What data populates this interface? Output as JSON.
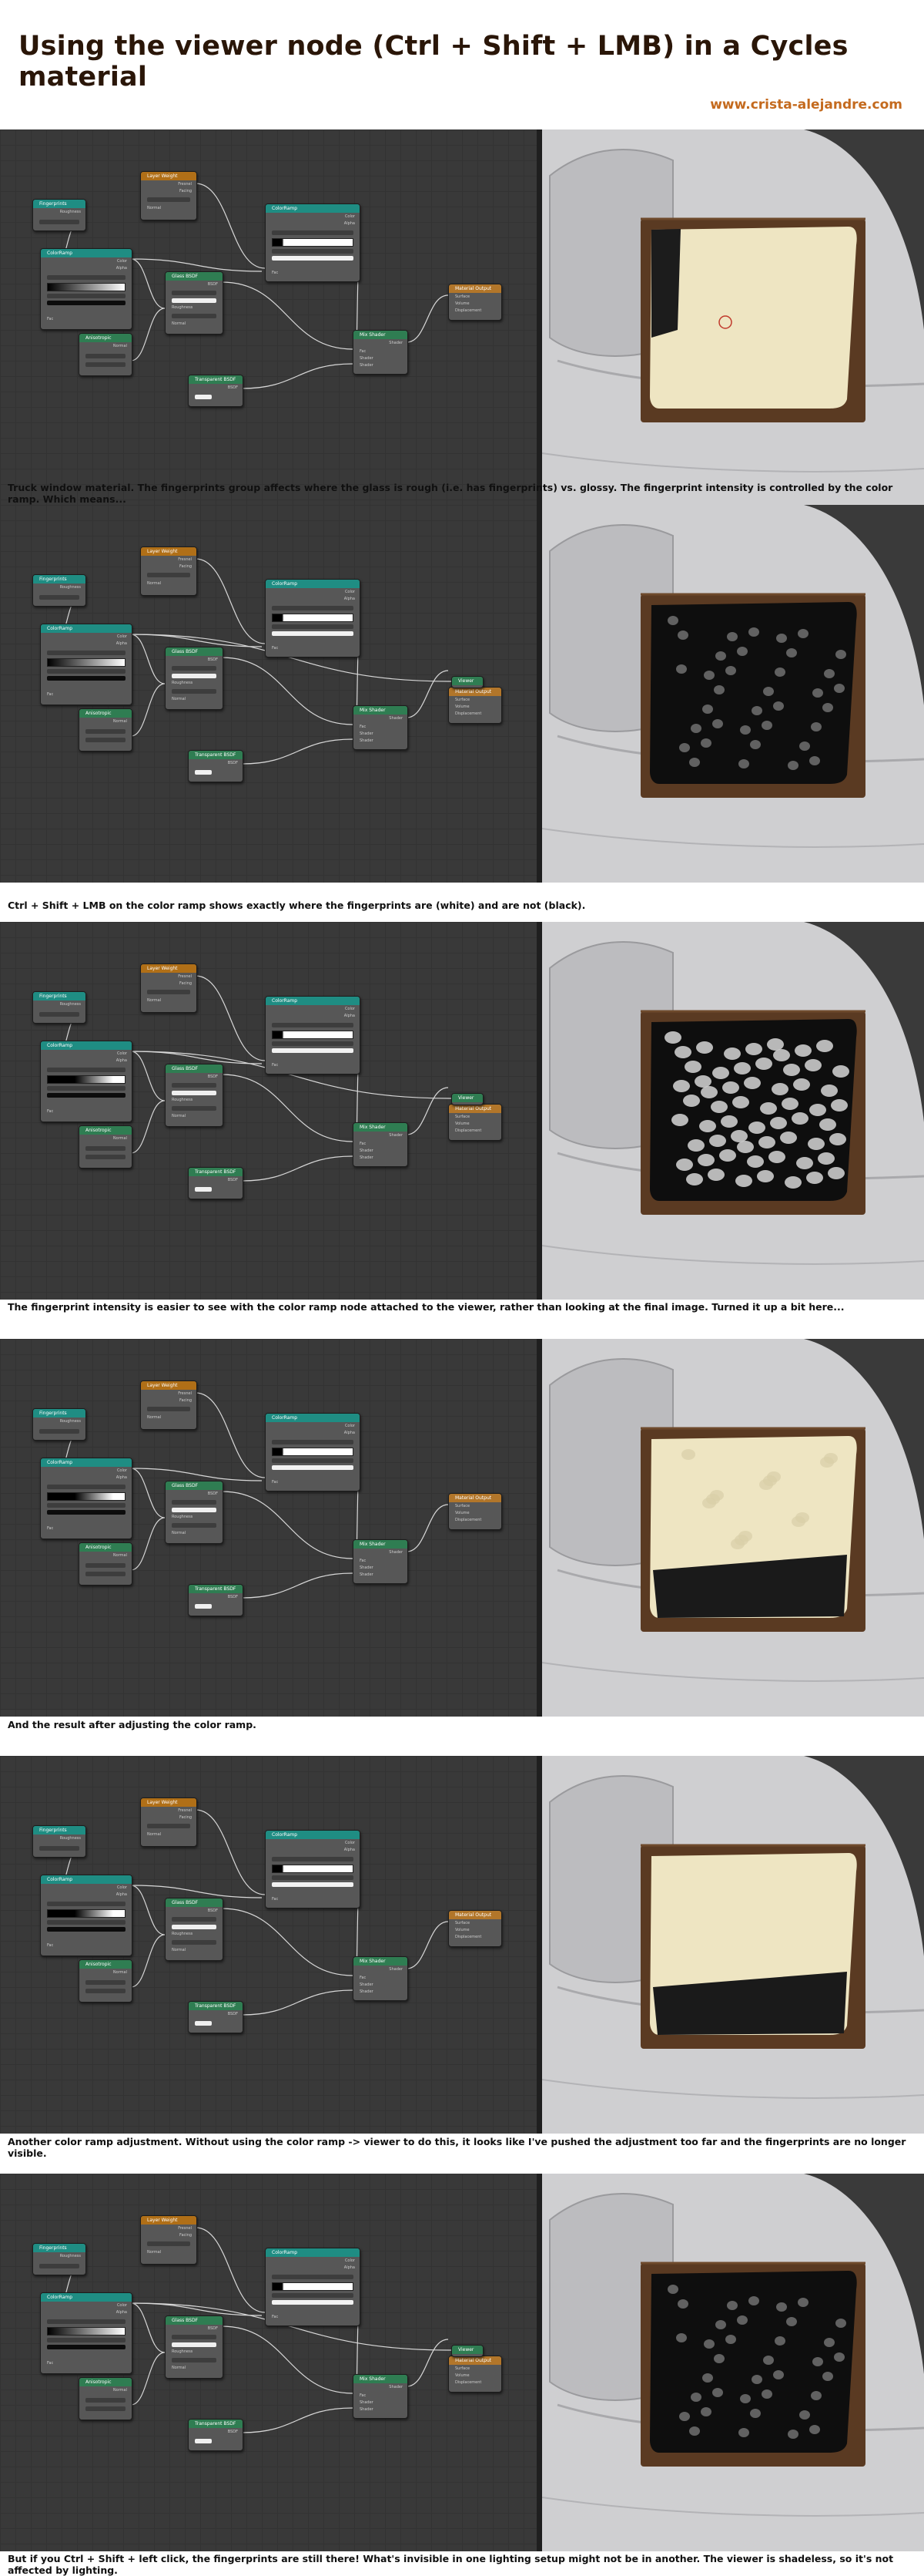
{
  "title": "Using the viewer node (Ctrl + Shift + LMB) in a Cycles material",
  "website": "www.crista-alejandre.com",
  "colors": {
    "title": "#2a1608",
    "website": "#c46a1e",
    "editor_bg": "#393939",
    "node_body": "#575757",
    "header_orange": "#b06f17",
    "header_teal": "#1f8d83",
    "header_green": "#2f7d52",
    "glass_cream": "#eee5c2",
    "truck_rust": "#5a3a22",
    "truck_body": "#cfcfd1"
  },
  "node_titles": {
    "fingerprints": "Fingerprints",
    "layer_weight": "Layer Weight",
    "colorramp_top": "ColorRamp",
    "colorramp_main": "ColorRamp",
    "glass_bsdf": "Glass BSDF",
    "anisotropic": "Anisotropic",
    "transparent_bsdf": "Transparent BSDF",
    "mix_shader": "Mix Shader",
    "material_output": "Material Output",
    "viewer": "Viewer"
  },
  "socket_labels": {
    "roughness": "Roughness",
    "fresnel": "Fresnel",
    "facing": "Facing",
    "normal": "Normal",
    "color": "Color",
    "alpha": "Alpha",
    "fac": "Fac",
    "bsdf": "BSDF",
    "shader": "Shader",
    "surface": "Surface",
    "volume": "Volume",
    "displacement": "Displacement",
    "ior": "IOR",
    "blend": "Blend",
    "rgb": "RGB",
    "linear": "Linear",
    "ggx": "GGX",
    "sharp": "Sharp"
  },
  "panels": [
    {
      "caption": "Truck window material. The fingerprints group affects where the glass is rough (i.e. has fingerprints) vs. glossy. The fingerprint intensity is controlled by the color ramp. Which means...",
      "viewer_connected": false,
      "window": "cream-smudged"
    },
    {
      "caption": "Ctrl + Shift + LMB on the color ramp shows exactly where the fingerprints are (white) and are not (black).",
      "viewer_connected": true,
      "window": "dark-spots-faint"
    },
    {
      "caption": "The fingerprint intensity is easier to see with the color ramp node attached to the viewer, rather than looking at the final image. Turned it up a bit here...",
      "viewer_connected": true,
      "window": "dark-spots-strong"
    },
    {
      "caption": "And the result after adjusting the color ramp.",
      "viewer_connected": false,
      "window": "cream-spotted"
    },
    {
      "caption": "Another color ramp adjustment. Without using the color ramp -> viewer to do this, it looks like I've pushed the adjustment too far and the fingerprints are no longer visible.",
      "viewer_connected": false,
      "window": "cream-plain"
    },
    {
      "caption": "But if you Ctrl + Shift + left click, the fingerprints are still there! What's invisible in one lighting setup might not be in another. The viewer is shadeless, so it's not affected by lighting.",
      "viewer_connected": true,
      "window": "dark-spots-faint"
    }
  ]
}
